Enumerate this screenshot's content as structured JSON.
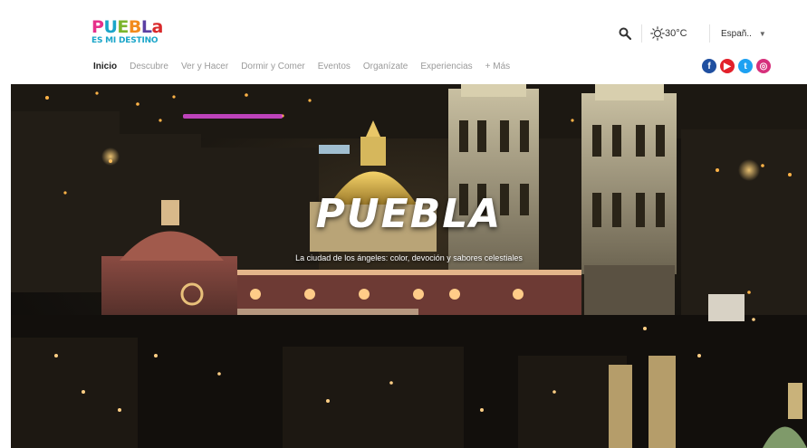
{
  "brand": {
    "logo_letters": [
      "P",
      "U",
      "E",
      "B",
      "L",
      "a"
    ],
    "logo_tagline": "ES MI DESTINO",
    "colors": {
      "pink": "#e6308a",
      "blue": "#1aa5c9",
      "green": "#7bb52c",
      "orange": "#f28b1d",
      "purple": "#5b3fa3",
      "red": "#d9292b"
    }
  },
  "header": {
    "search_icon": "search-icon",
    "weather": {
      "icon": "sun-icon",
      "temperature": "30°C"
    },
    "language": {
      "selected": "Españ..",
      "icon": "caret-down-icon"
    }
  },
  "nav": {
    "items": [
      {
        "label": "Inicio",
        "active": true
      },
      {
        "label": "Descubre"
      },
      {
        "label": "Ver y Hacer"
      },
      {
        "label": "Dormir y Comer"
      },
      {
        "label": "Eventos"
      },
      {
        "label": "Organízate"
      },
      {
        "label": "Experiencias"
      },
      {
        "label": "+ Más"
      }
    ]
  },
  "social": {
    "items": [
      {
        "name": "facebook-icon",
        "glyph": "f",
        "color": "#1f4fa0"
      },
      {
        "name": "youtube-icon",
        "glyph": "▶",
        "color": "#e3202a"
      },
      {
        "name": "twitter-icon",
        "glyph": "t",
        "color": "#1da1f2"
      },
      {
        "name": "instagram-icon",
        "glyph": "◎",
        "color": "#d6307c"
      }
    ]
  },
  "hero": {
    "title": "PUEBLA",
    "subtitle": "La ciudad de los ángeles: color, devoción y sabores celestiales"
  }
}
